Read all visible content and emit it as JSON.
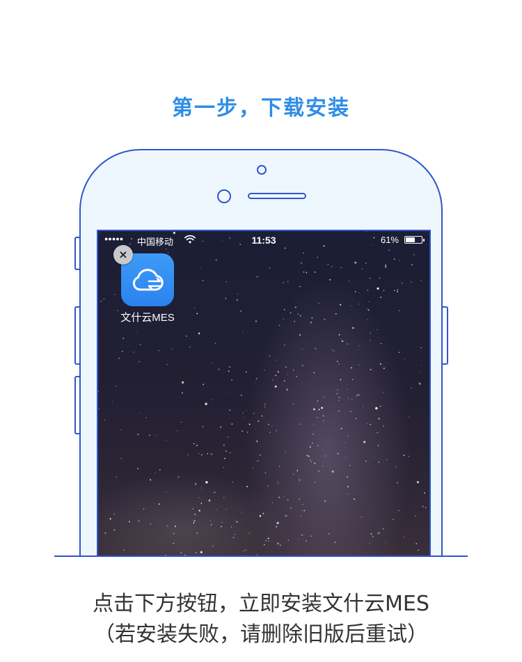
{
  "header": {
    "title": "第一步，下载安装"
  },
  "phone": {
    "status_bar": {
      "signal": "●●●●●",
      "carrier": "中国移动",
      "wifi_icon": "wifi-icon",
      "time": "11:53",
      "battery_percent_text": "61%",
      "battery_level": 0.61
    },
    "app": {
      "name": "文什云MES",
      "delete_badge": "×",
      "icon": "cloud-sync-icon",
      "icon_color": "#2b82ef"
    }
  },
  "instructions": {
    "line1": "点击下方按钮，立即安装文什云MES",
    "line2": "（若安装失败，请删除旧版后重试）"
  },
  "colors": {
    "accent": "#2f8de6",
    "outline": "#2e56cc",
    "phone_fill": "#eef7fd"
  }
}
